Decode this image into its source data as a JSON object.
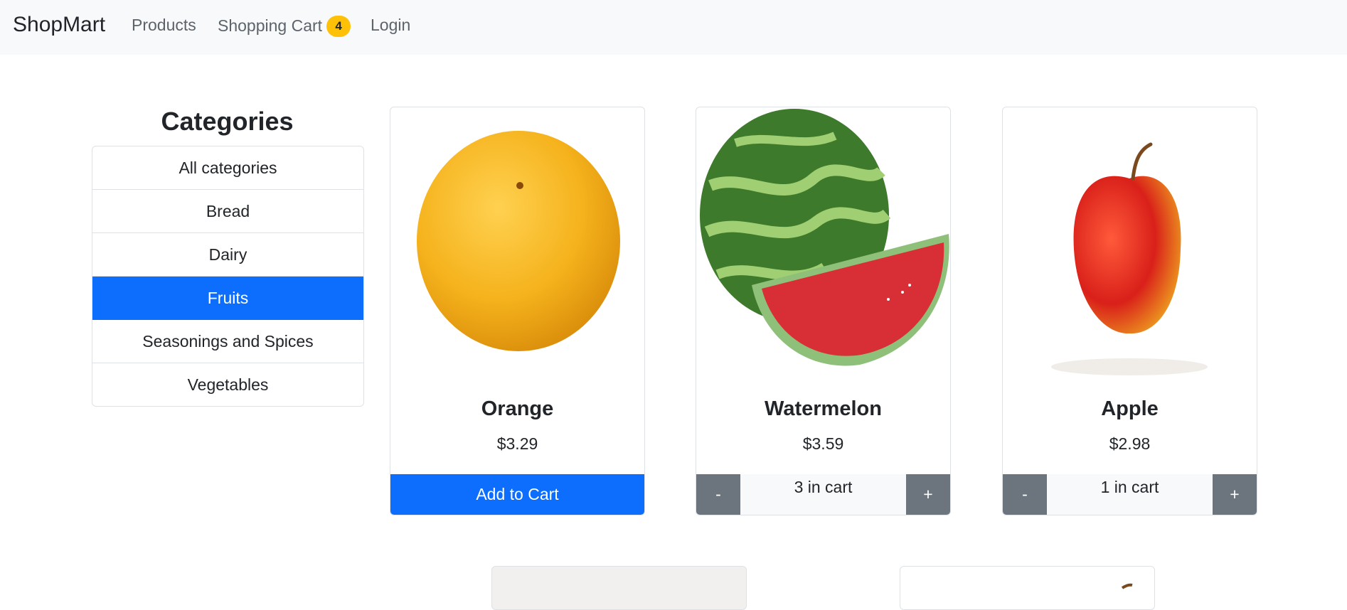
{
  "navbar": {
    "brand": "ShopMart",
    "links": [
      {
        "label": "Products"
      },
      {
        "label": "Shopping Cart",
        "badge": "4"
      },
      {
        "label": "Login"
      }
    ]
  },
  "categories": {
    "title": "Categories",
    "items": [
      "All categories",
      "Bread",
      "Dairy",
      "Fruits",
      "Seasonings and Spices",
      "Vegetables"
    ],
    "selected": "Fruits"
  },
  "products": [
    {
      "name": "Orange",
      "price": "$3.29",
      "action": "Add to Cart"
    },
    {
      "name": "Watermelon",
      "price": "$3.59",
      "cart": {
        "minus": "-",
        "text": "3 in cart",
        "plus": "+"
      }
    },
    {
      "name": "Apple",
      "price": "$2.98",
      "cart": {
        "minus": "-",
        "text": "1 in cart",
        "plus": "+"
      }
    }
  ],
  "colors": {
    "primary": "#0d6efd",
    "badge": "#ffc107",
    "secondary": "#6c757d",
    "navbar_bg": "#f8f9fa"
  }
}
